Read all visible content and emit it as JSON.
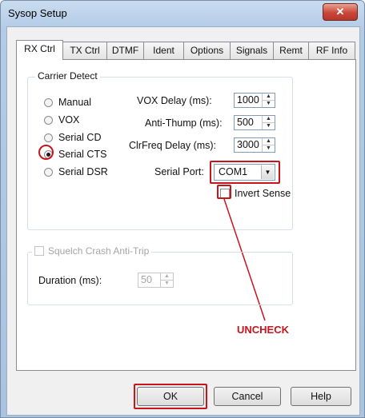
{
  "window": {
    "title": "Sysop Setup",
    "close_glyph": "✕"
  },
  "tabs": [
    {
      "label": "RX Ctrl"
    },
    {
      "label": "TX Ctrl"
    },
    {
      "label": "DTMF"
    },
    {
      "label": "Ident"
    },
    {
      "label": "Options"
    },
    {
      "label": "Signals"
    },
    {
      "label": "Remt"
    },
    {
      "label": "RF Info"
    }
  ],
  "carrier_detect": {
    "label": "Carrier Detect",
    "options": [
      {
        "label": "Manual",
        "checked": false
      },
      {
        "label": "VOX",
        "checked": false
      },
      {
        "label": "Serial CD",
        "checked": false
      },
      {
        "label": "Serial CTS",
        "checked": true
      },
      {
        "label": "Serial DSR",
        "checked": false
      }
    ],
    "vox_delay": {
      "label": "VOX Delay (ms):",
      "value": "1000"
    },
    "anti_thump": {
      "label": "Anti-Thump (ms):",
      "value": "500"
    },
    "clrfreq_delay": {
      "label": "ClrFreq Delay (ms):",
      "value": "3000"
    },
    "serial_port": {
      "label": "Serial Port:",
      "value": "COM1"
    },
    "invert_sense": {
      "label": "Invert Sense",
      "checked": false
    }
  },
  "squelch": {
    "label": "Squelch Crash Anti-Trip",
    "enabled": false,
    "duration": {
      "label": "Duration (ms):",
      "value": "50"
    }
  },
  "annotation": {
    "text": "UNCHECK",
    "color": "#c8141c"
  },
  "buttons": {
    "ok": "OK",
    "cancel": "Cancel",
    "help": "Help"
  },
  "icons": {
    "spin_up": "▲",
    "spin_down": "▼",
    "dropdown": "▼"
  }
}
